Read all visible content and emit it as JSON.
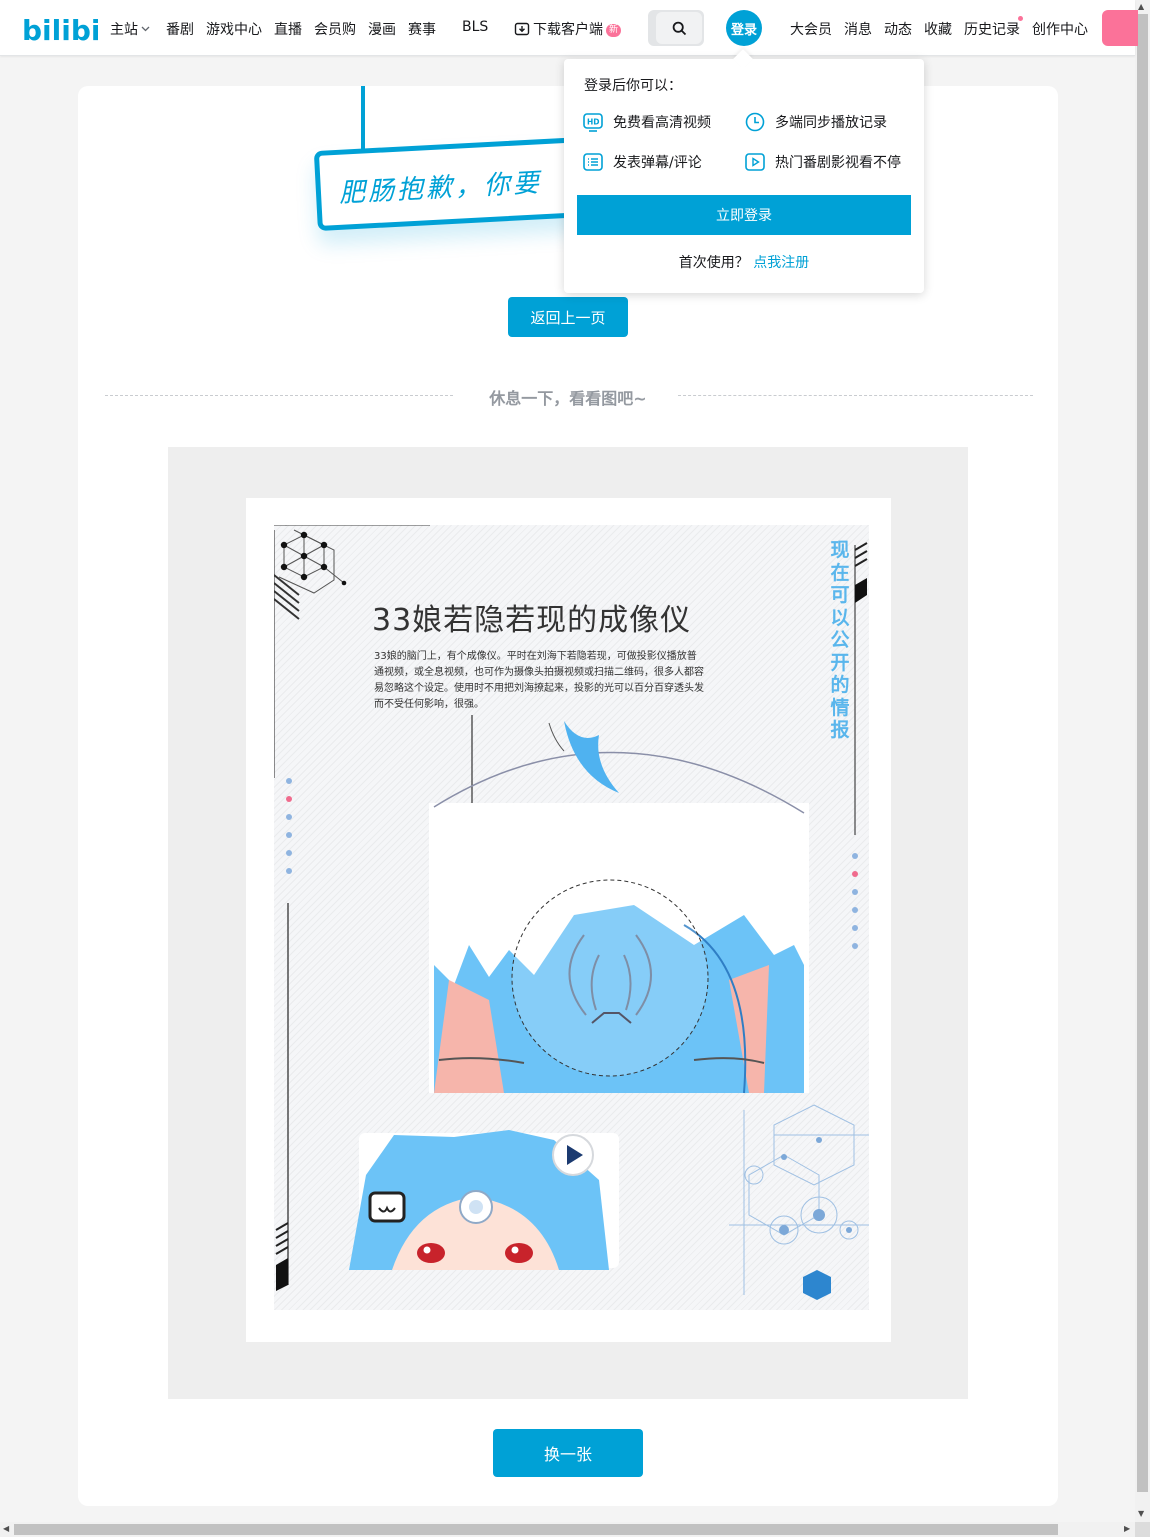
{
  "header": {
    "logo_text": "bilibili",
    "nav": [
      {
        "label": "主站",
        "has_chevron": true
      },
      {
        "label": "番剧"
      },
      {
        "label": "游戏中心"
      },
      {
        "label": "直播"
      },
      {
        "label": "会员购"
      },
      {
        "label": "漫画"
      },
      {
        "label": "赛事"
      },
      {
        "label": "BLS"
      }
    ],
    "download_label": "下载客户端",
    "download_badge": "新",
    "login_label": "登录",
    "right_nav": [
      {
        "label": "大会员"
      },
      {
        "label": "消息"
      },
      {
        "label": "动态"
      },
      {
        "label": "收藏"
      },
      {
        "label": "历史记录"
      },
      {
        "label": "创作中心"
      }
    ]
  },
  "main": {
    "sign_text": "肥肠抱歉，你要",
    "back_label": "返回上一页",
    "divider_text": "休息一下，看看图吧~",
    "poster": {
      "title": "33娘若隐若现的成像仪",
      "description": "33娘的脑门上，有个成像仪。平时在刘海下若隐若现，可做投影仪播放普通视频，或全息视频，也可作为摄像头拍摄视频或扫描二维码，很多人都容易忽略这个设定。使用时不用把刘海撩起来，投影的光可以百分百穿透头发而不受任何影响，很强。",
      "side_text": "现在可以公开的情报"
    },
    "refresh_label": "换一张"
  },
  "login_popup": {
    "title": "登录后你可以：",
    "benefits": [
      {
        "label": "免费看高清视频",
        "icon": "hd-icon"
      },
      {
        "label": "多端同步播放记录",
        "icon": "clock-icon"
      },
      {
        "label": "发表弹幕/评论",
        "icon": "danmaku-icon"
      },
      {
        "label": "热门番剧影视看不停",
        "icon": "play-icon"
      }
    ],
    "login_button": "立即登录",
    "register_prompt": "首次使用？",
    "register_link": "点我注册"
  },
  "colors": {
    "brand_blue": "#00a1d6",
    "brand_pink": "#fb7299",
    "background": "#f4f4f4"
  }
}
